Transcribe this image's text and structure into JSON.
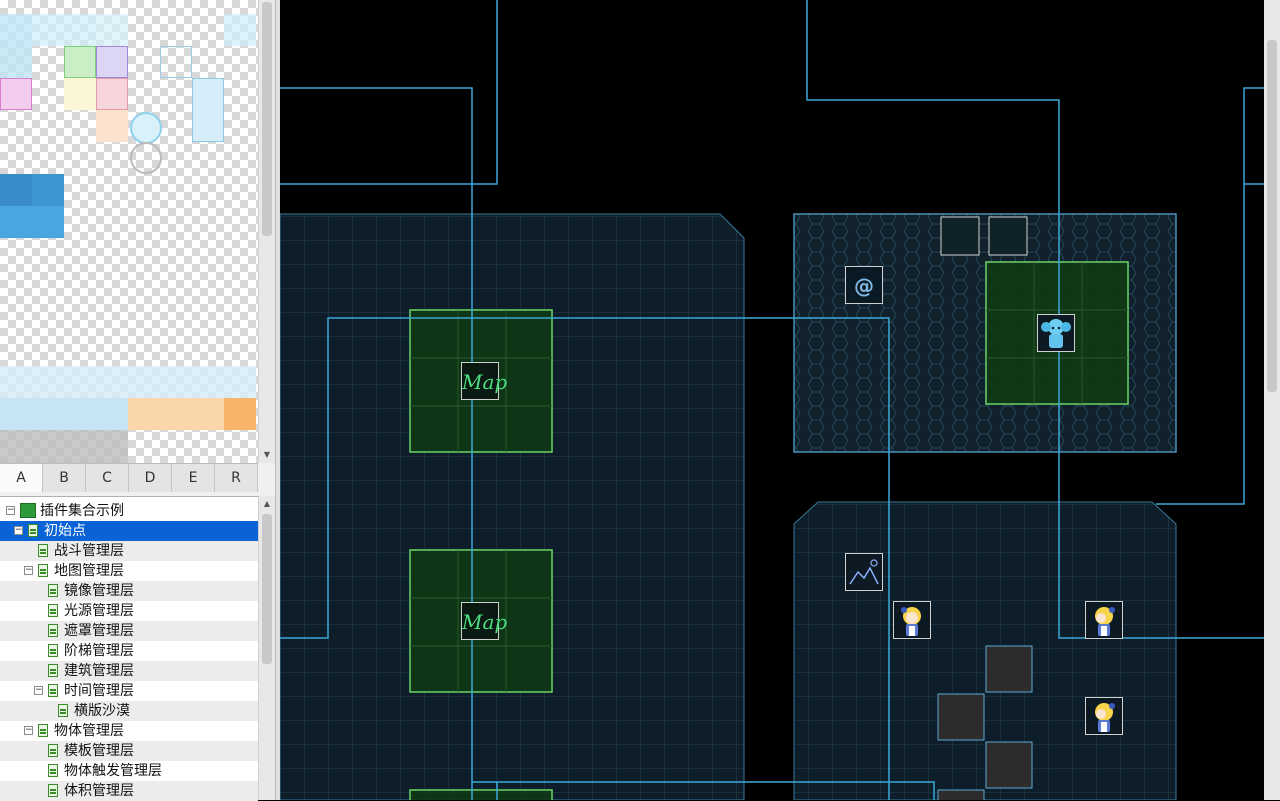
{
  "tileset": {
    "tabs": [
      {
        "label": "A",
        "active": true
      },
      {
        "label": "B",
        "active": false
      },
      {
        "label": "C",
        "active": false
      },
      {
        "label": "D",
        "active": false
      },
      {
        "label": "E",
        "active": false
      },
      {
        "label": "R",
        "active": false
      }
    ]
  },
  "tree": {
    "root": {
      "label": "插件集合示例",
      "expanded": true
    },
    "items": [
      {
        "label": "初始点",
        "depth": 1,
        "expander": "minus",
        "selected": true
      },
      {
        "label": "战斗管理层",
        "depth": 2,
        "expander": "none"
      },
      {
        "label": "地图管理层",
        "depth": 2,
        "expander": "minus"
      },
      {
        "label": "镜像管理层",
        "depth": 3,
        "expander": "none"
      },
      {
        "label": "光源管理层",
        "depth": 3,
        "expander": "none"
      },
      {
        "label": "遮罩管理层",
        "depth": 3,
        "expander": "none"
      },
      {
        "label": "阶梯管理层",
        "depth": 3,
        "expander": "none"
      },
      {
        "label": "建筑管理层",
        "depth": 3,
        "expander": "none"
      },
      {
        "label": "时间管理层",
        "depth": 3,
        "expander": "minus"
      },
      {
        "label": "横版沙漠",
        "depth": 4,
        "expander": "none"
      },
      {
        "label": "物体管理层",
        "depth": 2,
        "expander": "minus"
      },
      {
        "label": "模板管理层",
        "depth": 3,
        "expander": "none"
      },
      {
        "label": "物体触发管理层",
        "depth": 3,
        "expander": "none"
      },
      {
        "label": "体积管理层",
        "depth": 3,
        "expander": "none"
      }
    ]
  },
  "map": {
    "events": [
      {
        "type": "map-transfer",
        "text": "Map"
      },
      {
        "type": "map-transfer",
        "text": "Map"
      },
      {
        "type": "common",
        "text": "@"
      }
    ],
    "colors": {
      "grid_line": "#2a4a5a",
      "room_fill": "#0d1e2a",
      "wire": "#3aa8d8",
      "green_zone": "#123d14",
      "green_border": "#6ad36a",
      "dark_block": "#2c2c2c"
    }
  }
}
